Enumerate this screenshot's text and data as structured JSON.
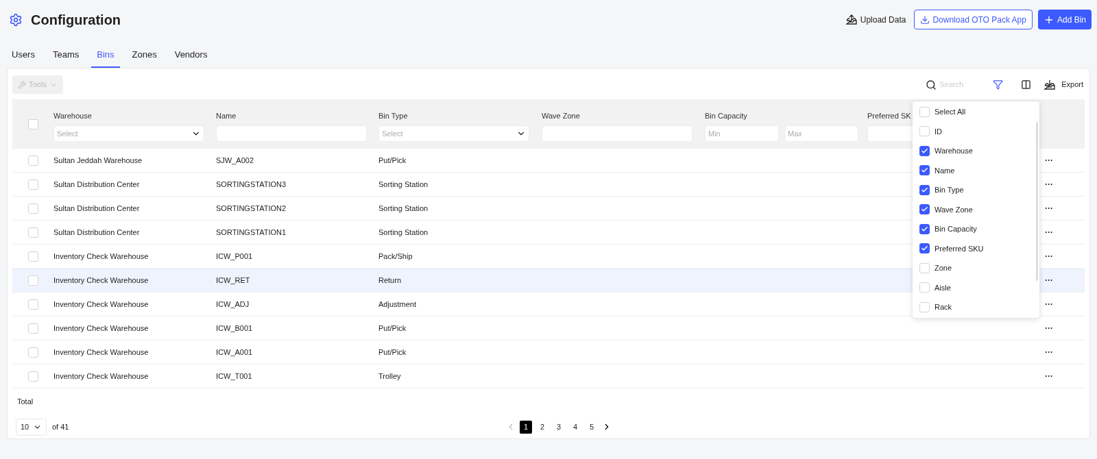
{
  "header": {
    "title": "Configuration",
    "actions": [
      {
        "kind": "upload",
        "label": "Upload Data"
      },
      {
        "kind": "download",
        "label": "Download OTO Pack App"
      },
      {
        "kind": "add",
        "label": "Add Bin"
      }
    ]
  },
  "tabs": [
    {
      "label": "Users",
      "selected": false
    },
    {
      "label": "Teams",
      "selected": false
    },
    {
      "label": "Bins",
      "selected": true
    },
    {
      "label": "Zones",
      "selected": false
    },
    {
      "label": "Vendors",
      "selected": false
    }
  ],
  "toolbar": {
    "tools": {
      "label": "Tools",
      "disabled": true
    },
    "search": {
      "placeholder": "Search"
    },
    "export": "Export"
  },
  "table": {
    "select_all": false,
    "columns": [
      {
        "label": "Warehouse",
        "filter": {
          "kind": "select",
          "placeholder": "Select"
        }
      },
      {
        "label": "Name",
        "filter": {
          "kind": "text"
        }
      },
      {
        "label": "Bin Type",
        "filter": {
          "kind": "select",
          "placeholder": "Select"
        }
      },
      {
        "label": "Wave Zone",
        "filter": {
          "kind": "text"
        }
      },
      {
        "label": "Bin Capacity",
        "filter": {
          "kind": "range",
          "min": "Min",
          "max": "Max"
        }
      },
      {
        "label": "Preferred SK",
        "filter": {
          "kind": "text"
        }
      }
    ],
    "rows": [
      {
        "checked": false,
        "hovered": false,
        "cells": [
          "Sultan Jeddah Warehouse",
          "SJW_A002",
          "Put/Pick"
        ],
        "action": "···"
      },
      {
        "checked": false,
        "hovered": false,
        "cells": [
          "Sultan Distribution Center",
          "SORTINGSTATION3",
          "Sorting Station"
        ],
        "action": "···"
      },
      {
        "checked": false,
        "hovered": false,
        "cells": [
          "Sultan Distribution Center",
          "SORTINGSTATION2",
          "Sorting Station"
        ],
        "action": "···"
      },
      {
        "checked": false,
        "hovered": false,
        "cells": [
          "Sultan Distribution Center",
          "SORTINGSTATION1",
          "Sorting Station"
        ],
        "action": "···"
      },
      {
        "checked": false,
        "hovered": false,
        "cells": [
          "Inventory Check Warehouse",
          "ICW_P001",
          "Pack/Ship"
        ],
        "action": "···"
      },
      {
        "checked": false,
        "hovered": true,
        "cells": [
          "Inventory Check Warehouse",
          "ICW_RET",
          "Return"
        ],
        "action": "···"
      },
      {
        "checked": false,
        "hovered": false,
        "cells": [
          "Inventory Check Warehouse",
          "ICW_ADJ",
          "Adjustment"
        ],
        "action": "···"
      },
      {
        "checked": false,
        "hovered": false,
        "cells": [
          "Inventory Check Warehouse",
          "ICW_B001",
          "Put/Pick"
        ],
        "action": "···"
      },
      {
        "checked": false,
        "hovered": false,
        "cells": [
          "Inventory Check Warehouse",
          "ICW_A001",
          "Put/Pick"
        ],
        "action": "···"
      },
      {
        "checked": false,
        "hovered": false,
        "cells": [
          "Inventory Check Warehouse",
          "ICW_T001",
          "Trolley"
        ],
        "action": "···"
      }
    ],
    "footer": "Total"
  },
  "column_menu": [
    {
      "label": "Select All",
      "checked": false
    },
    {
      "label": "ID",
      "checked": false
    },
    {
      "label": "Warehouse",
      "checked": true
    },
    {
      "label": "Name",
      "checked": true
    },
    {
      "label": "Bin Type",
      "checked": true
    },
    {
      "label": "Wave Zone",
      "checked": true
    },
    {
      "label": "Bin Capacity",
      "checked": true
    },
    {
      "label": "Preferred SKU",
      "checked": true
    },
    {
      "label": "Zone",
      "checked": false
    },
    {
      "label": "Aisle",
      "checked": false
    },
    {
      "label": "Rack",
      "checked": false
    }
  ],
  "pagination": {
    "page_size": "10",
    "total": "of 41",
    "pages": [
      {
        "label": "1",
        "selected": true
      },
      {
        "label": "2",
        "selected": false
      },
      {
        "label": "3",
        "selected": false
      },
      {
        "label": "4",
        "selected": false
      },
      {
        "label": "5",
        "selected": false
      }
    ]
  }
}
